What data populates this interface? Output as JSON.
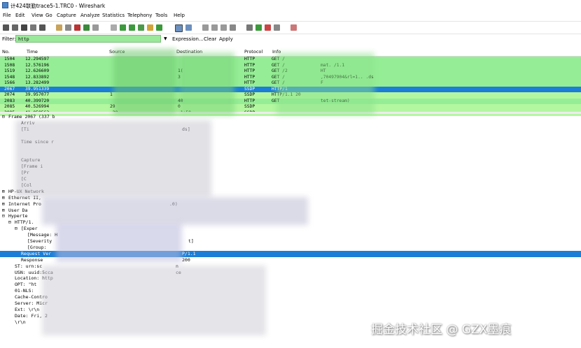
{
  "window": {
    "title": "计424联勤trace5-1.TRC0 - Wireshark"
  },
  "menu": [
    "File",
    "Edit",
    "View",
    "Go",
    "Capture",
    "Analyze",
    "Statistics",
    "Telephony",
    "Tools",
    "Help"
  ],
  "filter": {
    "label": "Filter:",
    "value": "http",
    "dropdown": "▼",
    "expression": "Expression...",
    "clear": "Clear",
    "apply": "Apply"
  },
  "columns": [
    "No.",
    "Time",
    "Source",
    "Destination",
    "Protocol",
    "Info"
  ],
  "packets": [
    {
      "no": "1504",
      "time": "12.294597",
      "src": "",
      "dst": "",
      "proto": "HTTP",
      "info": "GET /"
    },
    {
      "no": "1508",
      "time": "12.576196",
      "src": "",
      "dst": "",
      "proto": "HTTP",
      "info": "GET /",
      "extra": "mat.         /1.1"
    },
    {
      "no": "1519",
      "time": "12.626609",
      "src": "",
      "dst": "1(",
      "proto": "HTTP",
      "info": "GET /2",
      "extra": "HT"
    },
    {
      "no": "1548",
      "time": "12.833892",
      "src": "",
      "dst": "3",
      "proto": "HTTP",
      "info": "GET /",
      "extra": ",70497904&rl=1..                                   .ds"
    },
    {
      "no": "1566",
      "time": "13.282499",
      "src": "",
      "dst": "",
      "proto": "HTTP",
      "info": "GET /",
      "extra": "F"
    },
    {
      "no": "2067",
      "time": "39.951339",
      "src": "",
      "dst": "",
      "proto": "SSDP",
      "info": "HTTP/1",
      "selected": true
    },
    {
      "no": "2074",
      "time": "39.957077",
      "src": "1",
      "dst": "",
      "proto": "SSDP",
      "info": "HTTP/1.1 20"
    },
    {
      "no": "2083",
      "time": "40.399720",
      "src": "",
      "dst": "40",
      "proto": "HTTP",
      "info": "GET",
      "extra": "tet-stream)"
    },
    {
      "no": "2085",
      "time": "40.526994",
      "src": "29",
      "dst": "0",
      "proto": "SSDP",
      "info": ""
    },
    {
      "no": "2095",
      "time": "41.058563",
      "src": ".29",
      "dst": ".1:50",
      "proto": "SSDP",
      "info": ""
    }
  ],
  "details": [
    {
      "ind": 0,
      "tw": "⊟",
      "text": "Frame 2067 (337 b",
      "sel": false
    },
    {
      "ind": 2,
      "tw": "",
      "text": "Arriv",
      "sel": false
    },
    {
      "ind": 2,
      "tw": "",
      "text": "[Ti",
      "extra": "ds]",
      "sel": false
    },
    {
      "ind": 2,
      "tw": "",
      "text": "",
      "sel": false
    },
    {
      "ind": 2,
      "tw": "",
      "text": "Time since r",
      "sel": false
    },
    {
      "ind": 2,
      "tw": "",
      "text": "",
      "sel": false
    },
    {
      "ind": 2,
      "tw": "",
      "text": "",
      "sel": false
    },
    {
      "ind": 2,
      "tw": "",
      "text": "Capture",
      "sel": false
    },
    {
      "ind": 2,
      "tw": "",
      "text": "[Frame i",
      "sel": false
    },
    {
      "ind": 2,
      "tw": "",
      "text": "[Pr",
      "sel": false
    },
    {
      "ind": 2,
      "tw": "",
      "text": "[C",
      "sel": false
    },
    {
      "ind": 2,
      "tw": "",
      "text": "[Col",
      "sel": false
    },
    {
      "ind": 0,
      "tw": "⊞",
      "text": "HP-UX Network",
      "sel": false
    },
    {
      "ind": 0,
      "tw": "⊞",
      "text": "Ethernet II,",
      "sel": false
    },
    {
      "ind": 0,
      "tw": "⊞",
      "text": "Internet Pro",
      "extra": ".0)",
      "sel": false
    },
    {
      "ind": 0,
      "tw": "⊞",
      "text": "User Da",
      "sel": false
    },
    {
      "ind": 0,
      "tw": "⊟",
      "text": "Hyperte",
      "sel": false
    },
    {
      "ind": 1,
      "tw": "⊟",
      "text": "HTTP/1.",
      "sel": false
    },
    {
      "ind": 2,
      "tw": "⊟",
      "text": "[Exper",
      "sel": false
    },
    {
      "ind": 3,
      "tw": "",
      "text": "[Message: H",
      "sel": false
    },
    {
      "ind": 3,
      "tw": "",
      "text": "[Severity",
      "extra": "t]",
      "sel": false
    },
    {
      "ind": 3,
      "tw": "",
      "text": "[Group: ",
      "sel": false
    },
    {
      "ind": 2,
      "tw": "",
      "text": "Request Ver",
      "extra": "P/1.1",
      "sel": true
    },
    {
      "ind": 2,
      "tw": "",
      "text": "Response",
      "extra": "200",
      "sel": false
    },
    {
      "ind": 1,
      "tw": "",
      "text": "ST: urn:sc",
      "extra": "n",
      "sel": false
    },
    {
      "ind": 1,
      "tw": "",
      "text": "USN: uuid:5cca",
      "extra": "ce",
      "sel": false
    },
    {
      "ind": 1,
      "tw": "",
      "text": "Location: http",
      "sel": false
    },
    {
      "ind": 1,
      "tw": "",
      "text": "OPT: \"ht",
      "sel": false
    },
    {
      "ind": 1,
      "tw": "",
      "text": "01-NLS:",
      "sel": false
    },
    {
      "ind": 1,
      "tw": "",
      "text": "Cache-Contro",
      "sel": false
    },
    {
      "ind": 1,
      "tw": "",
      "text": "Server: Micr",
      "sel": false
    },
    {
      "ind": 1,
      "tw": "",
      "text": "Ext: \\r\\n",
      "sel": false
    },
    {
      "ind": 1,
      "tw": "",
      "text": "Date: Fri, 2",
      "sel": false
    },
    {
      "ind": 1,
      "tw": "",
      "text": "\\r\\n",
      "sel": false
    }
  ],
  "watermark": "掘金技术社区 @ GZX墨痕",
  "colors": {
    "http": "#95ee95",
    "ssdp": "#b4f7a1",
    "selected": "#1c7ed6",
    "filter_ok": "#9ae89a"
  }
}
